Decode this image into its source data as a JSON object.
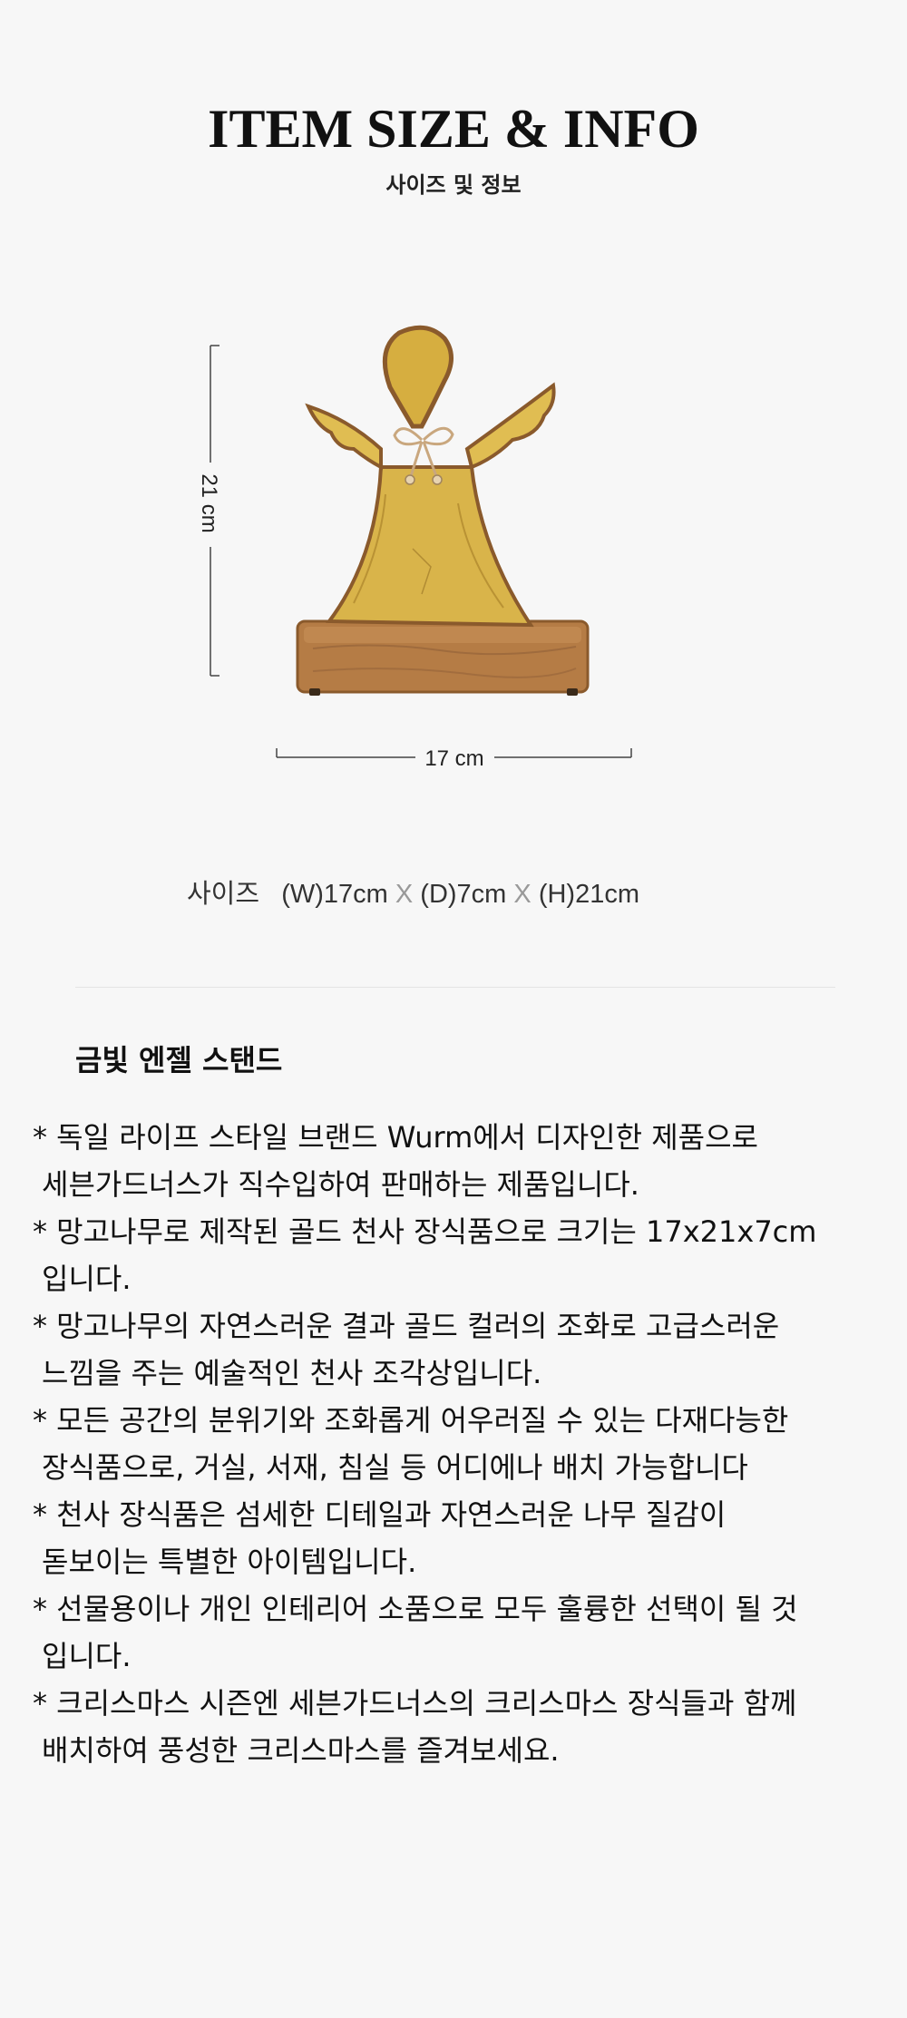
{
  "header": {
    "title": "ITEM SIZE & INFO",
    "subtitle": "사이즈 및 정보"
  },
  "figure": {
    "height_label": "21 cm",
    "width_label": "17 cm",
    "colors": {
      "gold": "#d9b44a",
      "wood": "#b07a44",
      "line": "#444444"
    }
  },
  "size": {
    "label": "사이즈",
    "w": "(W)17cm",
    "d": "(D)7cm",
    "h": "(H)21cm",
    "sep": "X"
  },
  "product": {
    "name": "금빛 엔젤 스탠드"
  },
  "description": [
    {
      "first": "* 독일 라이프 스타일 브랜드 Wurm에서 디자인한 제품으로",
      "second": "세븐가드너스가 직수입하여 판매하는 제품입니다."
    },
    {
      "first": "* 망고나무로 제작된 골드 천사 장식품으로 크기는 17x21x7cm",
      "second": "입니다."
    },
    {
      "first": "* 망고나무의 자연스러운 결과 골드 컬러의 조화로 고급스러운",
      "second": "느낌을 주는 예술적인 천사 조각상입니다."
    },
    {
      "first": "* 모든 공간의 분위기와 조화롭게 어우러질 수 있는 다재다능한",
      "second": "장식품으로, 거실, 서재, 침실 등 어디에나 배치 가능합니다"
    },
    {
      "first": "* 천사 장식품은 섬세한 디테일과 자연스러운 나무 질감이",
      "second": "돋보이는 특별한 아이템입니다."
    },
    {
      "first": "* 선물용이나 개인 인테리어 소품으로 모두 훌륭한 선택이 될 것",
      "second": "입니다."
    },
    {
      "first": "* 크리스마스 시즌엔 세븐가드너스의 크리스마스 장식들과 함께",
      "second": "배치하여 풍성한 크리스마스를 즐겨보세요."
    }
  ]
}
